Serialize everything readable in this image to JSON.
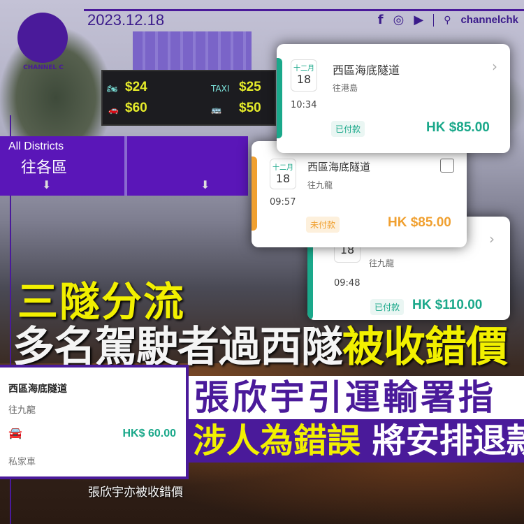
{
  "header": {
    "date": "2023.12.18",
    "logo_text": "CHANNEL C",
    "social": {
      "icons": [
        "facebook-icon",
        "instagram-icon",
        "youtube-icon",
        "search-icon"
      ],
      "handle": "channelchk"
    }
  },
  "background": {
    "toll_sign": {
      "motorcycle": "$24",
      "taxi": "$25",
      "private_car": "$60",
      "bus_truck": "$50"
    },
    "road_sign": {
      "en": "All Districts",
      "zh": "往各區"
    }
  },
  "cards": [
    {
      "month": "十二月",
      "day": "18",
      "title": "西區海底隧道",
      "destination": "往港島",
      "time": "10:34",
      "status": "已付款",
      "price": "HK $85.00",
      "accent": "#1aa88a"
    },
    {
      "month": "十二月",
      "day": "18",
      "title": "西區海底隧道",
      "destination": "往九龍",
      "time": "09:57",
      "status": "未付款",
      "price": "HK $85.00",
      "accent": "#f0a030"
    },
    {
      "day": "18",
      "destination": "往九龍",
      "time": "09:48",
      "status": "已付款",
      "price": "HK $110.00",
      "accent": "#1aa88a"
    }
  ],
  "headline": {
    "line1": "三隧分流",
    "line2_white": "多名駕駛者過西隧",
    "line2_yellow": "被收錯價"
  },
  "personal_card": {
    "title": "西區海底隧道",
    "destination": "往九龍",
    "price": "HK$ 60.00",
    "vehicle": "私家車"
  },
  "caption": "張欣宇亦被收錯價",
  "subheadline": {
    "line1": "張欣宇引運輸署指",
    "line2_yellow": "涉人為錯誤",
    "line2_white": "將安排退款"
  },
  "colors": {
    "brand_purple": "#4a1a9a",
    "headline_yellow": "#f2f000",
    "paid_green": "#1aa88a",
    "unpaid_orange": "#f0a030"
  }
}
